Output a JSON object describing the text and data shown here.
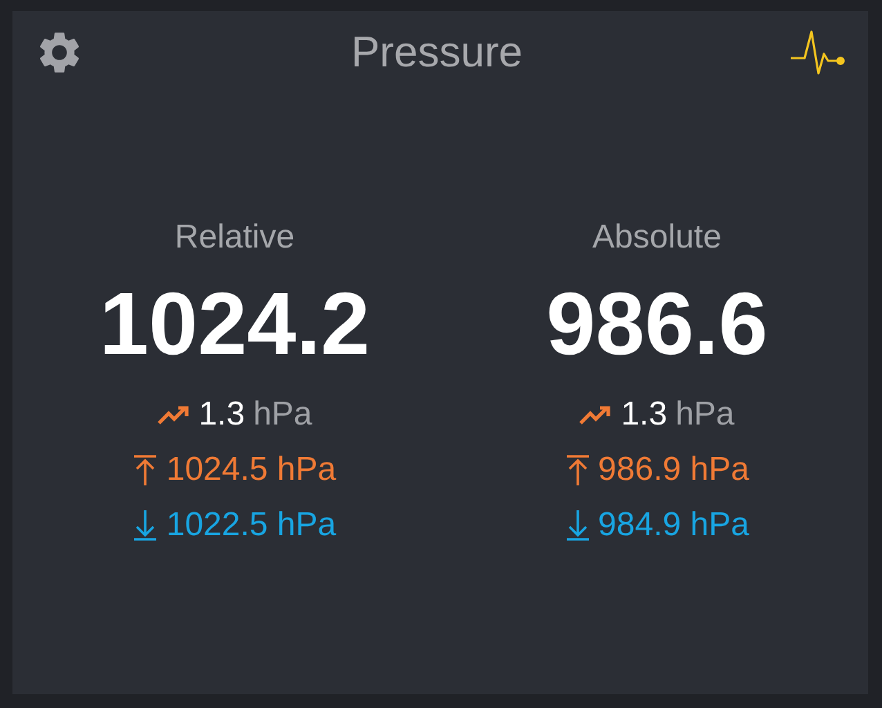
{
  "title": "Pressure",
  "panels": [
    {
      "label": "Relative",
      "value": "1024.2",
      "trend": {
        "value": "1.3",
        "unit": "hPa"
      },
      "stats": [
        {
          "kind": "max",
          "text": "1024.5 hPa"
        },
        {
          "kind": "min",
          "text": "1022.5 hPa"
        }
      ]
    },
    {
      "label": "Absolute",
      "value": "986.6",
      "trend": {
        "value": "1.3",
        "unit": "hPa"
      },
      "stats": [
        {
          "kind": "max",
          "text": "986.9 hPa"
        },
        {
          "kind": "min",
          "text": "984.9 hPa"
        }
      ]
    }
  ]
}
